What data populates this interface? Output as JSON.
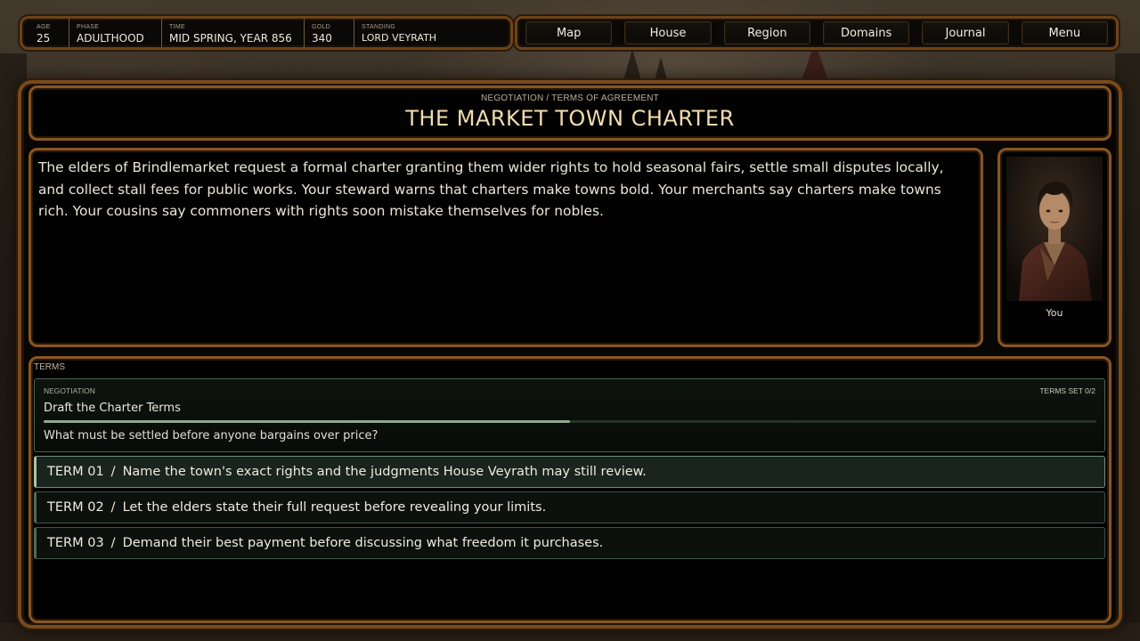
{
  "status": {
    "age": {
      "label": "AGE",
      "value": "25"
    },
    "phase": {
      "label": "PHASE",
      "value": "ADULTHOOD"
    },
    "time": {
      "label": "TIME",
      "value": "MID SPRING, YEAR 856"
    },
    "gold": {
      "label": "GOLD",
      "value": "340"
    },
    "standing": {
      "label": "STANDING",
      "value": "LORD VEYRATH"
    }
  },
  "nav": {
    "map": "Map",
    "house": "House",
    "region": "Region",
    "domains": "Domains",
    "journal": "Journal",
    "menu": "Menu"
  },
  "header": {
    "subtitle": "NEGOTIATION / TERMS OF AGREEMENT",
    "title": "THE MARKET TOWN CHARTER"
  },
  "narrative": "The elders of Brindlemarket request a formal charter granting them wider rights to hold seasonal fairs, settle small disputes locally, and collect stall fees for public works. Your steward warns that charters make towns bold. Your merchants say charters make towns rich. Your cousins say commoners with rights soon mistake themselves for nobles.",
  "portrait": {
    "caption": "You"
  },
  "terms": {
    "section_label": "TERMS",
    "card": {
      "kicker": "NEGOTIATION",
      "count": "TERMS SET  0/2",
      "title": "Draft the Charter Terms",
      "progress": 0.5,
      "question": "What must be settled before anyone bargains over price?"
    },
    "options": [
      {
        "num": "TERM 01",
        "sep": "/",
        "text": "Name the town's exact rights and the judgments House Veyrath may still review.",
        "selected": true
      },
      {
        "num": "TERM 02",
        "sep": "/",
        "text": "Let the elders state their full request before revealing your limits.",
        "selected": false
      },
      {
        "num": "TERM 03",
        "sep": "/",
        "text": "Demand their best payment before discussing what freedom it purchases.",
        "selected": false
      }
    ]
  },
  "colors": {
    "frame_bronze": "#8a5520",
    "accent_green": "#8fa98f",
    "title_gold": "#f1dcb0"
  }
}
